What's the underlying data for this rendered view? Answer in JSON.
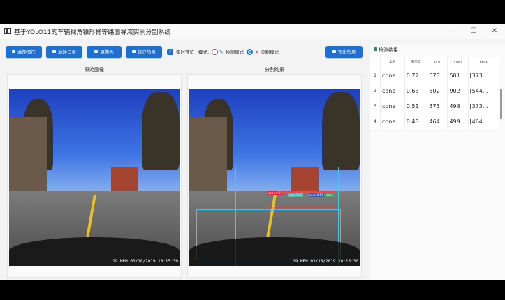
{
  "window": {
    "title": "基于YOLO11的车辆视角锥形桶等路面导流实例分割系统"
  },
  "toolbar": {
    "select_image": "选择图片",
    "select_folder": "选择目录",
    "camera": "摄像头",
    "save_result": "保存结果",
    "realtime_preview": "实时预览",
    "mode_label": "模式:",
    "mode_detect": "检测模式",
    "mode_segment": "分割模式",
    "export_result": "导出结果"
  },
  "panels": {
    "original_title": "原始图像",
    "result_title": "分割结果",
    "timestamp": "19 MPH 03/18/2019 10:15:30"
  },
  "results": {
    "title": "检测结果",
    "columns": [
      "类别",
      "置信度",
      "xmin",
      "ymin",
      "bbox"
    ],
    "rows": [
      {
        "idx": "1",
        "cls": "cone",
        "conf": "0.72",
        "xmin": "573",
        "ymin": "501",
        "bbox": "[373..."
      },
      {
        "idx": "2",
        "cls": "cone",
        "conf": "0.63",
        "xmin": "502",
        "ymin": "902",
        "bbox": "[544..."
      },
      {
        "idx": "3",
        "cls": "cone",
        "conf": "0.51",
        "xmin": "373",
        "ymin": "498",
        "bbox": "[373..."
      },
      {
        "idx": "4",
        "cls": "cone",
        "conf": "0.43",
        "xmin": "464",
        "ymin": "499",
        "bbox": "[464..."
      }
    ]
  },
  "colors": {
    "accent": "#1f6fd1",
    "mask_cyan": "#39c8ff",
    "tag_red": "#e0263a"
  }
}
